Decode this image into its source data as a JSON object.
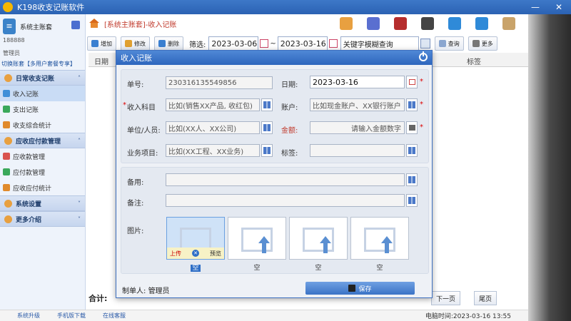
{
  "window": {
    "title": "K198收支记账软件"
  },
  "sidebar": {
    "account_name": "系统主账套",
    "account_number": "188888",
    "role": "管理员",
    "switch_link": "切换账套【多用户套餐专享】",
    "groups": [
      {
        "label": "日常收支记账",
        "items": [
          "收入记账",
          "支出记账",
          "收支综合统计"
        ]
      },
      {
        "label": "应收应付款管理",
        "items": [
          "应收款管理",
          "应付款管理",
          "应收应付统计"
        ]
      },
      {
        "label": "系统设置",
        "items": []
      },
      {
        "label": "更多介绍",
        "items": []
      }
    ]
  },
  "header": {
    "breadcrumb": "[系统主账套]-收入记账"
  },
  "toolbar": {
    "add_label": "增加",
    "edit_label": "修改",
    "delete_label": "删除",
    "filter_label": "筛选:",
    "date_from": "2023-03-06",
    "range_sep": "~",
    "date_to": "2023-03-16",
    "search_placeholder": "关键字模糊查询",
    "query_label": "查询",
    "more_label": "更多"
  },
  "table": {
    "col_date": "日期",
    "col_tag": "标签"
  },
  "footer": {
    "total_label": "合计:",
    "next_page": "下一页",
    "last_page": "尾页",
    "links": [
      "系统升级",
      "手机版下载",
      "在线客服"
    ],
    "clock": "电脑时间:2023-03-16 13:55"
  },
  "modal": {
    "title": "收入记账",
    "order_no_label": "单号:",
    "order_no": "230316135549856",
    "date_label": "日期:",
    "date_value": "2023-03-16",
    "income_subject_label": "收入科目",
    "income_subject_placeholder": "比如(销售XX产品, 收红包)",
    "account_label": "账户:",
    "account_placeholder": "比如现金账户、XX银行账户",
    "unit_label": "单位/人员:",
    "unit_placeholder": "比如(XX人、XX公司)",
    "amount_label": "金额:",
    "amount_placeholder": "请输入金额数字",
    "project_label": "业务项目:",
    "project_placeholder": "比如(XX工程、XX业务)",
    "tag_label": "标签:",
    "backup_label": "备用:",
    "note_label": "备注:",
    "image_label": "图片:",
    "upload_label": "上传",
    "preview_label": "预览",
    "image_captions": [
      "空",
      "空",
      "空",
      "空"
    ],
    "maker_label": "制单人:",
    "maker_name": "管理员",
    "save_label": "保存"
  }
}
